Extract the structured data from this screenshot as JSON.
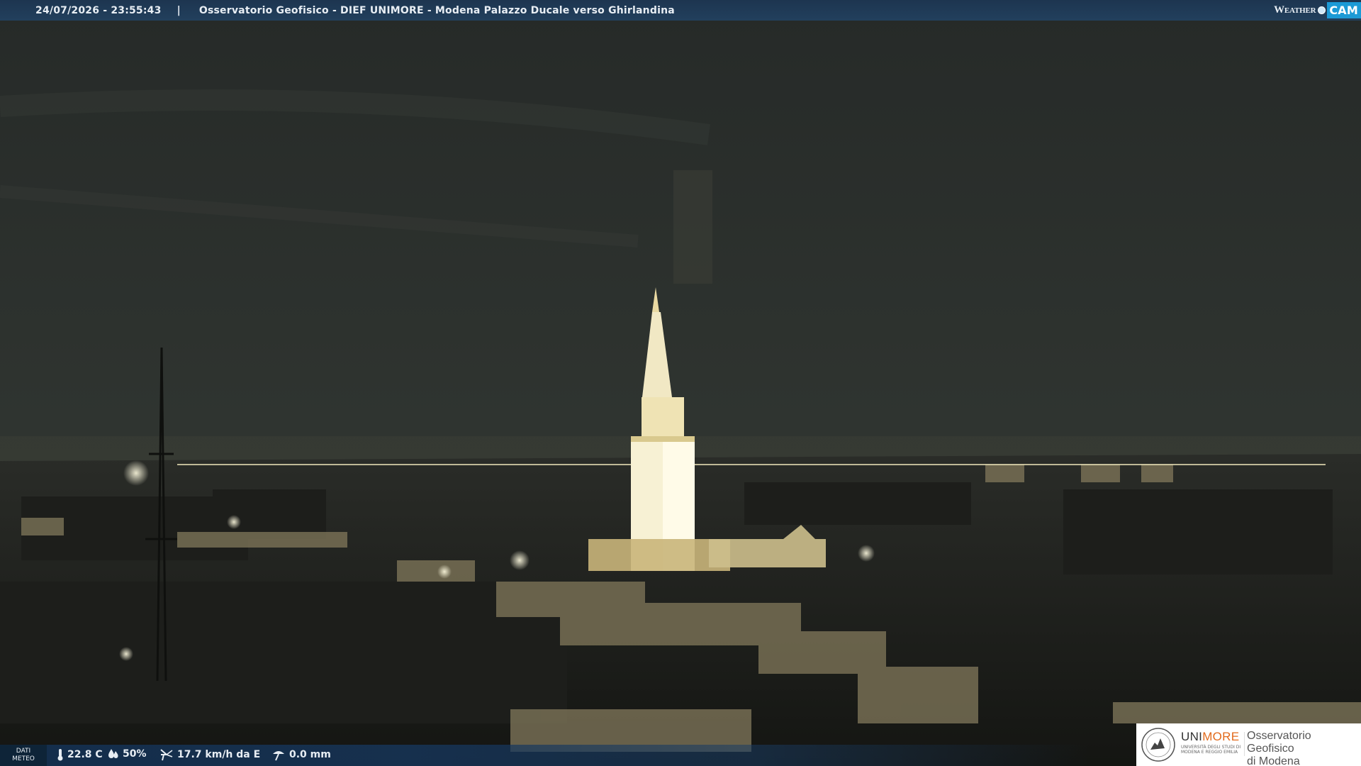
{
  "window": {
    "timestamp": "24/07/2026 - 23:55:43",
    "separator": "|",
    "title": "Osservatorio Geofisico - DIEF UNIMORE - Modena Palazzo Ducale verso Ghirlandina"
  },
  "brand": {
    "weather_label": "Weather",
    "cam_label": "CAM"
  },
  "weather_data": {
    "panel_label_line1": "DATI",
    "panel_label_line2": "METEO",
    "temperature": "22.8 C",
    "humidity": "50%",
    "wind": "17.7 km/h da E",
    "rain": "0.0 mm",
    "icons": {
      "temperature": "thermometer-icon",
      "humidity": "water-drop-icon",
      "wind": "wind-icon",
      "rain": "rain-gauge-icon"
    }
  },
  "logo": {
    "uni_prefix": "UNI",
    "uni_suffix": "MORE",
    "uni_subtitle": "UNIVERSITÀ DEGLI STUDI DI MODENA E REGGIO EMILIA",
    "observatory_line1": "Osservatorio Geofisico",
    "observatory_line2": "di Modena",
    "accent_color": "#e26a1b"
  },
  "colors": {
    "bar_blue": "#1f3b58",
    "cam_blue": "#1c9ad6",
    "tower_light": "#f4efc9",
    "sky": "#2b302c"
  }
}
